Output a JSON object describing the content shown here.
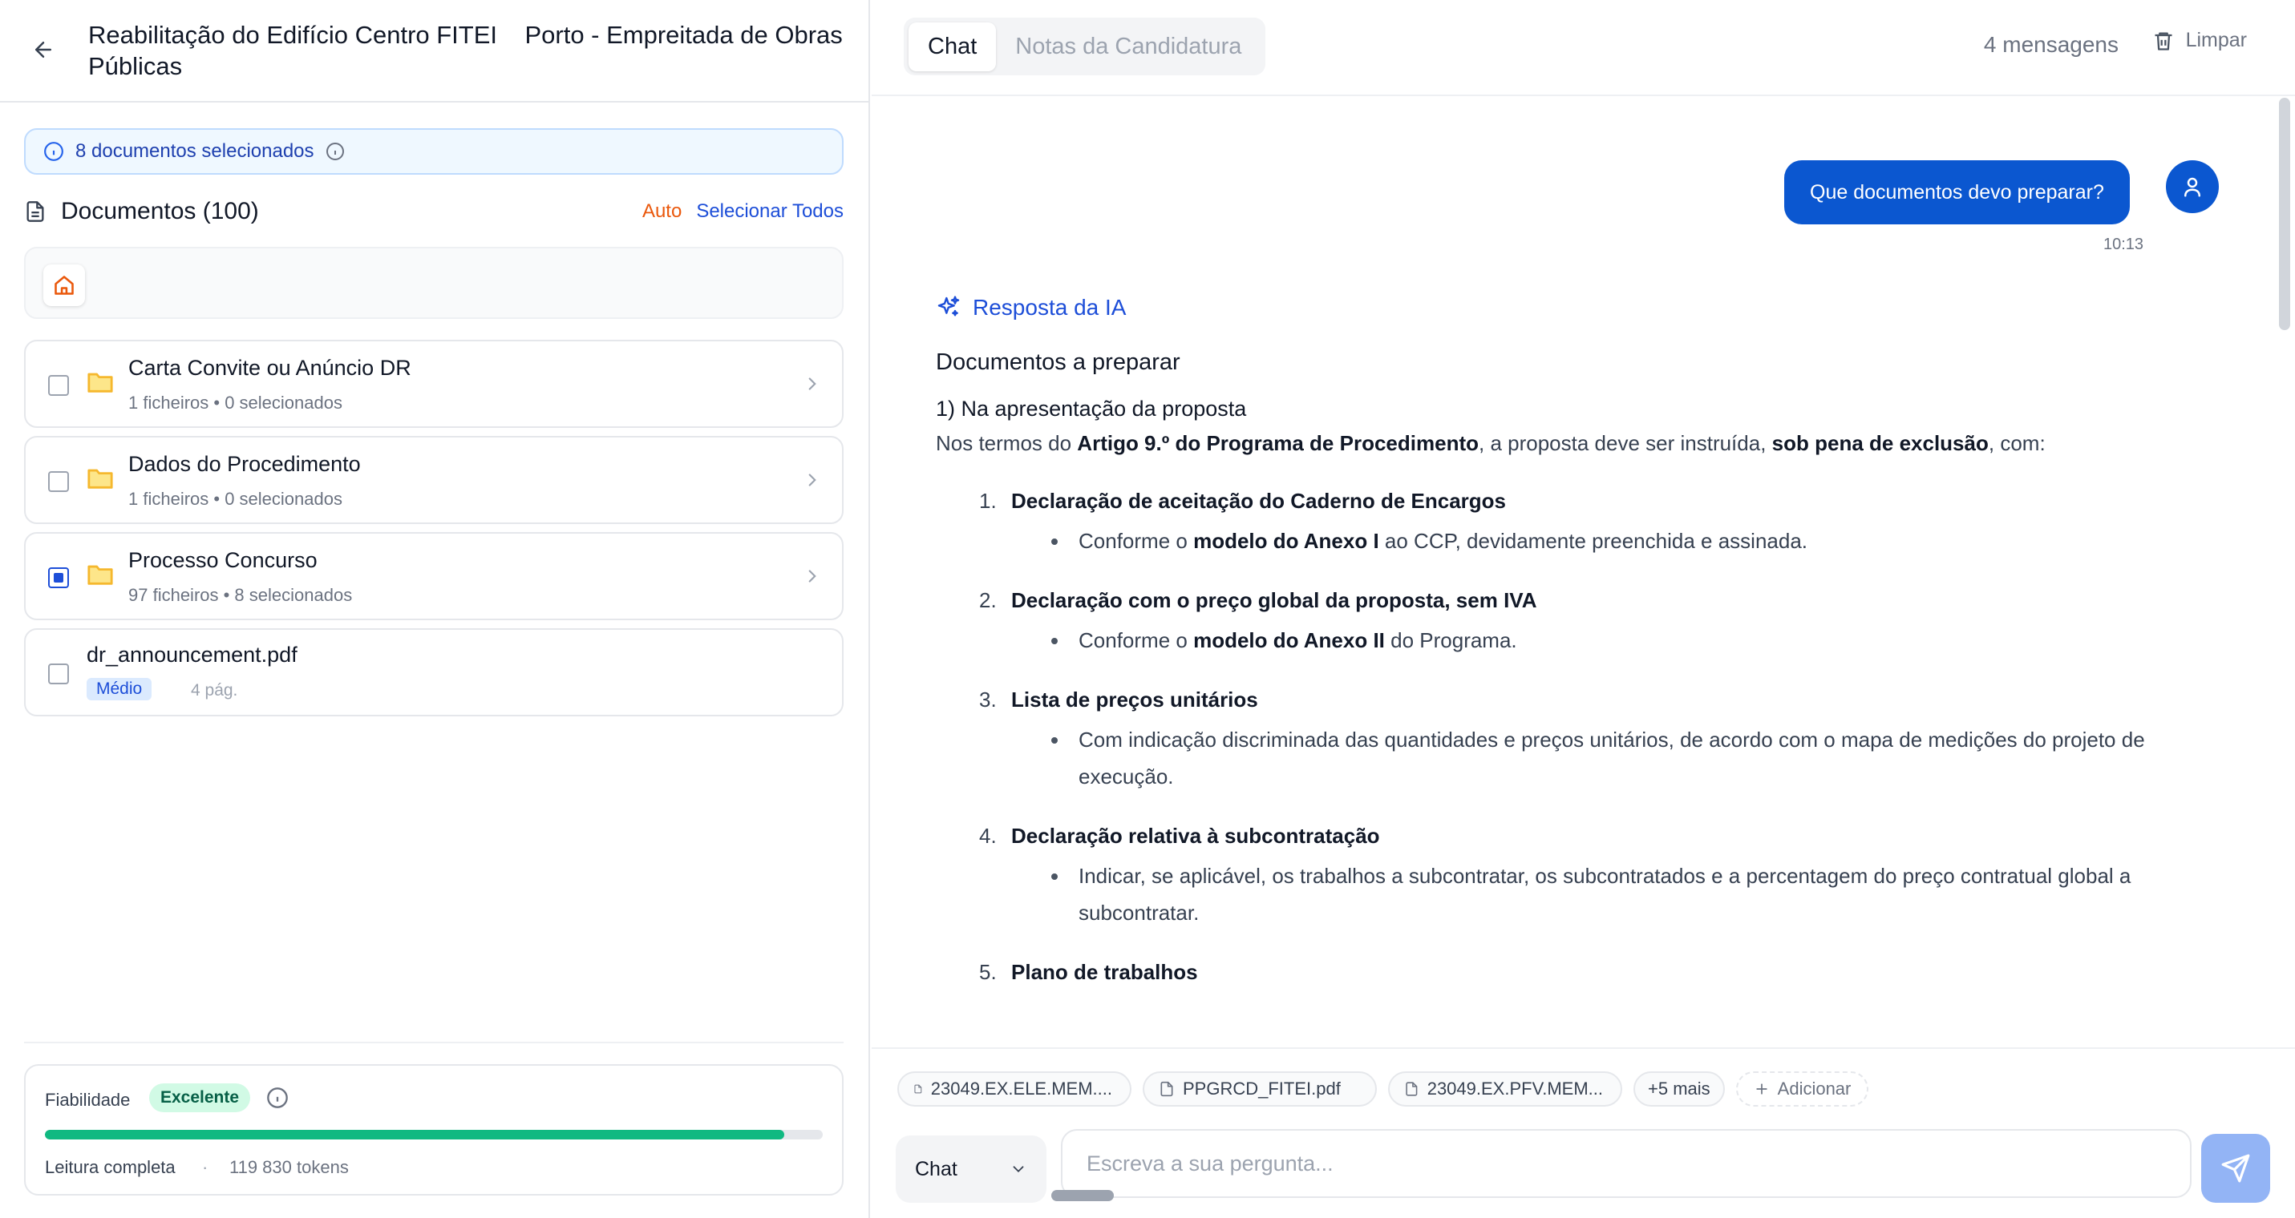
{
  "project": {
    "title": "Reabilitação do Edifício Centro FITEI    Porto - Empreitada de Obras Públicas"
  },
  "selection": {
    "text": "8 documentos selecionados"
  },
  "documents": {
    "title": "Documentos (100)",
    "auto_label": "Auto",
    "select_all_label": "Selecionar Todos",
    "items": [
      {
        "name": "Carta Convite ou Anúncio DR",
        "meta": "1 ficheiros • 0 selecionados",
        "state": "unchecked"
      },
      {
        "name": "Dados do Procedimento",
        "meta": "1 ficheiros • 0 selecionados",
        "state": "unchecked"
      },
      {
        "name": "Processo Concurso",
        "meta": "97 ficheiros • 8 selecionados",
        "state": "partial"
      }
    ],
    "file": {
      "name": "dr_announcement.pdf",
      "badge": "Médio",
      "pages": "4 pág."
    }
  },
  "reliability": {
    "label": "Fiabilidade",
    "badge": "Excelente",
    "progress_percent": 95,
    "read_label": "Leitura completa",
    "separator": "·",
    "tokens": "119 830 tokens",
    "bar_color": "#10b981"
  },
  "tabs": [
    {
      "label": "Chat",
      "active": true
    },
    {
      "label": "Notas da Candidatura",
      "active": false
    }
  ],
  "header": {
    "message_count": "4 mensagens",
    "clear_label": "Limpar"
  },
  "chat": {
    "user_message": "Que documentos devo preparar?",
    "user_time": "10:13",
    "ai_label": "Resposta da IA",
    "heading": "Documentos a preparar",
    "section_title": "1) Na apresentação da proposta",
    "intro": {
      "t1": "Nos termos do ",
      "b1": "Artigo 9.º do Programa de Procedimento",
      "t2": ", a proposta deve ser instruída, ",
      "b2": "sob pena de exclusão",
      "t3": ", com:"
    },
    "steps": [
      {
        "num": "1.",
        "head": "Declaração de aceitação do Caderno de Encargos",
        "s1": "Conforme o ",
        "sb": "modelo do Anexo I",
        "s2": " ao CCP, devidamente preenchida e assinada."
      },
      {
        "num": "2.",
        "head": "Declaração com o preço global da proposta, sem IVA",
        "s1": "Conforme o ",
        "sb": "modelo do Anexo II",
        "s2": " do Programa."
      },
      {
        "num": "3.",
        "head": "Lista de preços unitários",
        "sub": "Com indicação discriminada das quantidades e preços unitários, de acordo com o mapa de medições do projeto de execução."
      },
      {
        "num": "4.",
        "head": "Declaração relativa à subcontratação",
        "sub": "Indicar, se aplicável, os trabalhos a subcontratar, os subcontratados e a percentagem do preço contratual global a subcontratar."
      },
      {
        "num": "5.",
        "head": "Plano de trabalhos"
      }
    ]
  },
  "composer": {
    "chips": [
      "23049.EX.ELE.MEM....",
      "PPGRCD_FITEI.pdf",
      "23049.EX.PFV.MEM..."
    ],
    "more_label": "+5 mais",
    "add_label": "Adicionar",
    "mode_label": "Chat",
    "placeholder": "Escreva a sua pergunta..."
  },
  "colors": {
    "accent": "#0b57d0",
    "link": "#1d4ed8",
    "auto": "#ea580c",
    "folder": "#fbbf24",
    "send_disabled": "#93b4f5"
  }
}
